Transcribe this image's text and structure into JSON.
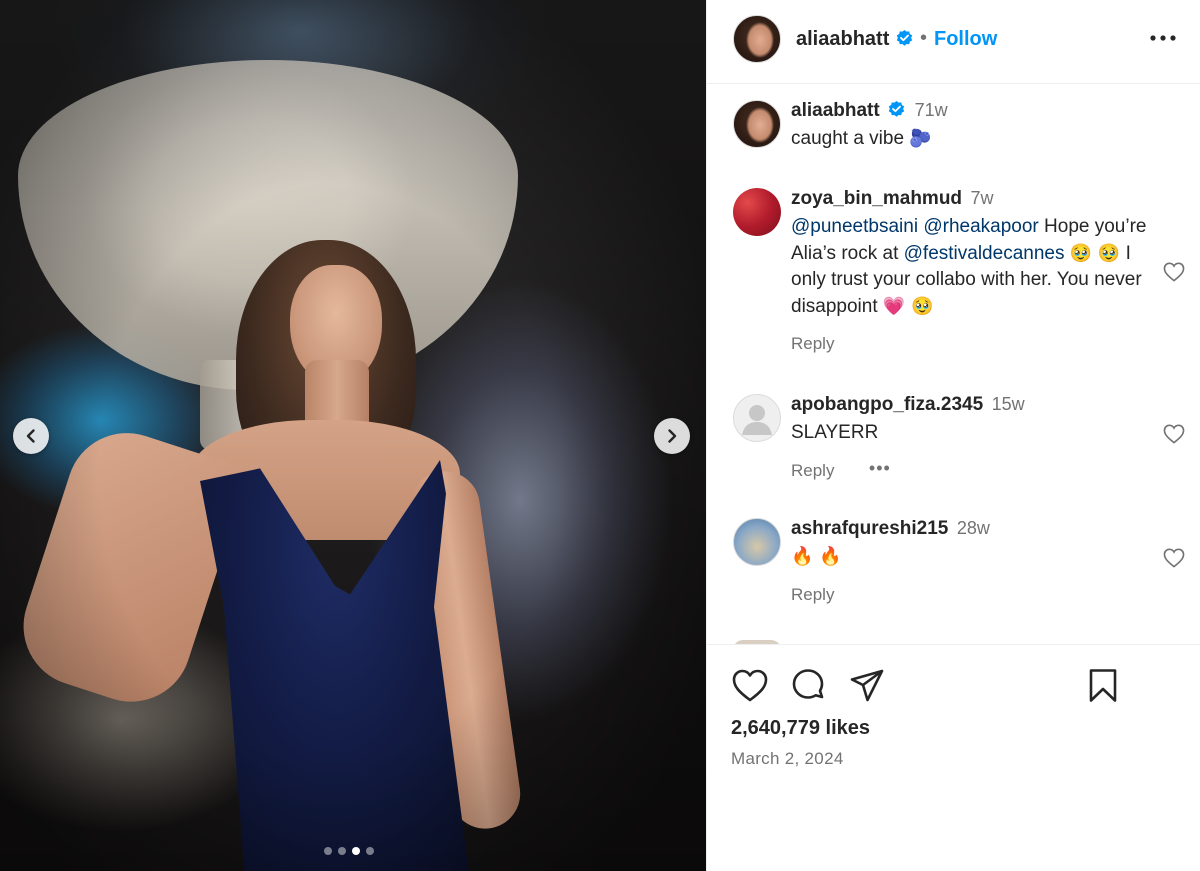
{
  "post": {
    "username": "aliaabhatt",
    "separator": "•",
    "follow_label": "Follow",
    "carousel": {
      "slide_count": 4,
      "active_index": 2
    }
  },
  "caption": {
    "username": "aliaabhatt",
    "time": "71w",
    "text": "caught a vibe",
    "emoji": "🫐"
  },
  "comments": [
    {
      "username": "zoya_bin_mahmud",
      "time": "7w",
      "mention1": "@puneetbsaini",
      "mention2": "@rheakapoor",
      "text1": "Hope you’re Alia’s rock at",
      "mention3": "@festivaldecannes",
      "emoji1": "🥹 🥹",
      "text2": "I only trust your collabo with her. You never disappoint",
      "emoji2": "💗 🥹",
      "reply_label": "Reply"
    },
    {
      "username": "apobangpo_fiza.2345",
      "time": "15w",
      "text": "SLAYERR",
      "reply_label": "Reply",
      "more": "•••"
    },
    {
      "username": "ashrafqureshi215",
      "time": "28w",
      "text": "🔥 🔥",
      "reply_label": "Reply"
    }
  ],
  "footer": {
    "likes": "2,640,779 likes",
    "date": "March 2, 2024"
  },
  "icons": [
    "chevron-left-icon",
    "chevron-right-icon",
    "verified-icon",
    "more-icon",
    "heart-icon",
    "comment-icon",
    "share-icon",
    "bookmark-icon"
  ],
  "colors": {
    "accent": "#0095f6",
    "verified": "#0095f6",
    "mention": "#00376b",
    "muted": "#737373"
  }
}
